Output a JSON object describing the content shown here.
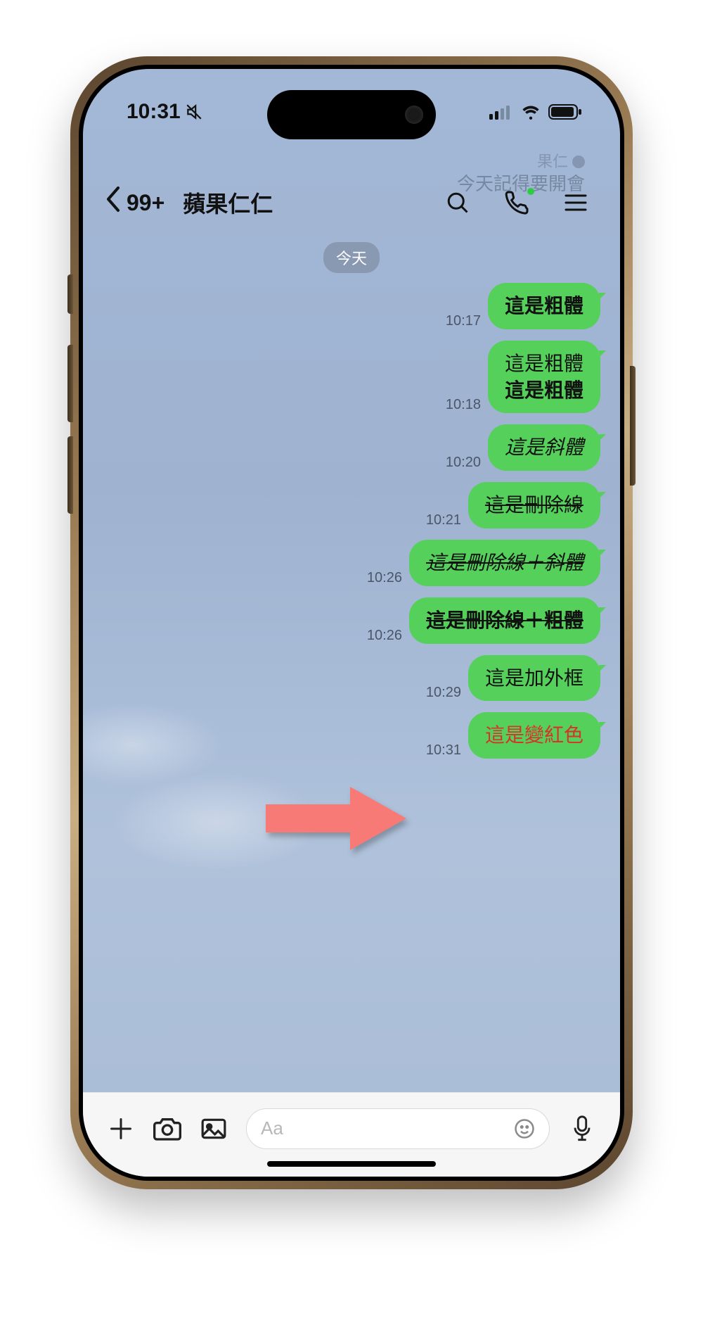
{
  "status": {
    "time": "10:31"
  },
  "background_notification": {
    "sender": "果仁",
    "text": "今天記得要開會"
  },
  "nav": {
    "badge": "99+",
    "title": "蘋果仁仁"
  },
  "date_label": "今天",
  "messages": [
    {
      "time": "10:17",
      "text": "這是粗體",
      "style": "bold"
    },
    {
      "time": "10:18",
      "line1": "這是粗體",
      "line2": "這是粗體",
      "style": "bold-double"
    },
    {
      "time": "10:20",
      "text": "這是斜體",
      "style": "italic"
    },
    {
      "time": "10:21",
      "text": "這是刪除線",
      "style": "strike"
    },
    {
      "time": "10:26",
      "text": "這是刪除線＋斜體",
      "style": "strike-italic"
    },
    {
      "time": "10:26",
      "text": "這是刪除線＋粗體",
      "style": "strike-bold"
    },
    {
      "time": "10:29",
      "text": "這是加外框",
      "style": "plain"
    },
    {
      "time": "10:31",
      "text": "這是變紅色",
      "style": "red"
    }
  ],
  "input": {
    "placeholder": "Aa"
  }
}
